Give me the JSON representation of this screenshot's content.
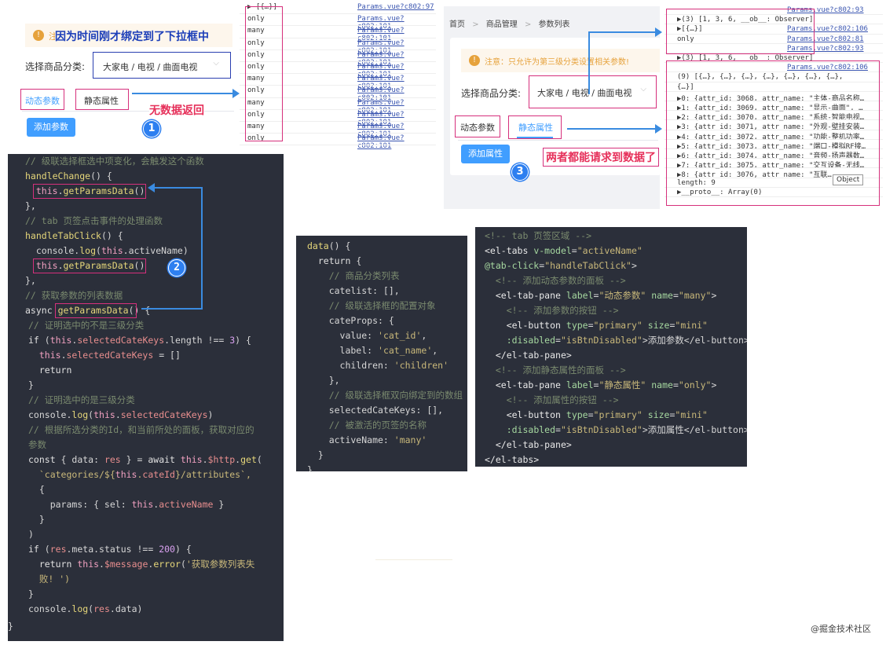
{
  "panel1": {
    "notice_prefix": "注",
    "annotation_top": "因为时间刚才绑定到了下拉框中",
    "select_label": "选择商品分类:",
    "select_value": "大家电 / 电视 / 曲面电视",
    "tab_dynamic": "动态参数",
    "tab_static": "静态属性",
    "annotation_bottom": "无数据返回",
    "step": "1",
    "add_button": "添加参数"
  },
  "console1": {
    "rows": [
      {
        "text": "▶ [{…}]",
        "src": "Params.vue?c802:97"
      },
      {
        "text": "only",
        "src": "Params.vue?c802:101"
      },
      {
        "text": "many",
        "src": "Params.vue?c802:101"
      },
      {
        "text": "only",
        "src": "Params.vue?c802:101"
      },
      {
        "text": "only",
        "src": "Params.vue?c802:101"
      },
      {
        "text": "only",
        "src": "Params.vue?c802:101"
      },
      {
        "text": "many",
        "src": "Params.vue?c802:101"
      },
      {
        "text": "only",
        "src": "Params.vue?c802:101"
      },
      {
        "text": "many",
        "src": "Params.vue?c802:101"
      },
      {
        "text": "only",
        "src": "Params.vue?c802:101"
      },
      {
        "text": "many",
        "src": "Params.vue?c802:101"
      },
      {
        "text": "only",
        "src": "Params.vue?c802:101"
      }
    ]
  },
  "panel3": {
    "breadcrumb": [
      "首页",
      "商品管理",
      "参数列表"
    ],
    "notice": "注意：只允许为第三级分类设置相关参数!",
    "select_label": "选择商品分类:",
    "select_value": "大家电 / 电视 / 曲面电视",
    "tab_dynamic": "动态参数",
    "tab_static": "静态属性",
    "add_button": "添加属性",
    "step": "3",
    "annotation": "两者都能请求到数据了"
  },
  "console2": {
    "rows": [
      {
        "text": "",
        "src": "Params.vue?c802:93"
      },
      {
        "text": "▶(3) [1, 3, 6, __ob__: Observer]",
        "src": ""
      },
      {
        "text": "▶[{…}]",
        "src": "Params.vue?c802:106"
      },
      {
        "text": "only",
        "src": "Params.vue?c802:81"
      },
      {
        "text": "",
        "src": "Params.vue?c802:93"
      },
      {
        "text": "▶(3) [1, 3, 6, __ob__: Observer]",
        "src": ""
      },
      {
        "text": "",
        "src": "Params.vue?c802:106"
      },
      {
        "text": "(9) [{…}, {…}, {…}, {…}, {…}, {…}, {…},",
        "src": ""
      },
      {
        "text": "{…}]",
        "src": ""
      },
      {
        "text": "▶0: {attr_id: 3068, attr_name: \"主体-商品名称…",
        "src": ""
      },
      {
        "text": "▶1: {attr_id: 3069, attr_name: \"显示-曲面\", …",
        "src": ""
      },
      {
        "text": "▶2: {attr_id: 3070, attr_name: \"系统-智能电视…",
        "src": ""
      },
      {
        "text": "▶3: {attr_id: 3071, attr_name: \"外观-壁挂安装…",
        "src": ""
      },
      {
        "text": "▶4: {attr_id: 3072, attr_name: \"功能-整机功率…",
        "src": ""
      },
      {
        "text": "▶5: {attr_id: 3073, attr_name: \"端口-模拟RF接…",
        "src": ""
      },
      {
        "text": "▶6: {attr_id: 3074, attr_name: \"音频-扬声器数…",
        "src": ""
      },
      {
        "text": "▶7: {attr_id: 3075, attr_name: \"交互设备-无线…",
        "src": ""
      },
      {
        "text": "▶8: {attr_id: 3076, attr_name: \"互联…",
        "src": ""
      },
      {
        "text": "length: 9",
        "src": ""
      },
      {
        "text": "▶__proto__: Array(0)",
        "src": ""
      }
    ],
    "tooltip": "Object"
  },
  "code1": {
    "step": "2"
  },
  "code2": {},
  "code3": {},
  "watermark": "@掘金技术社区"
}
